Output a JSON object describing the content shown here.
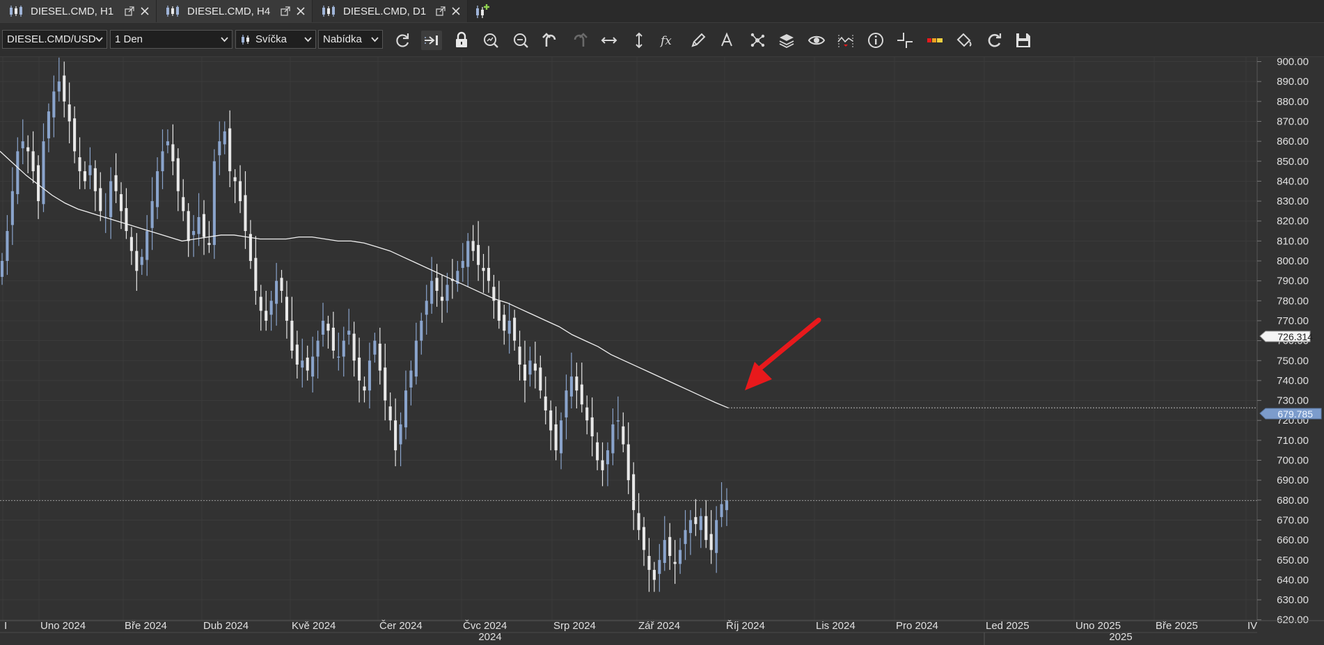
{
  "tabs": [
    {
      "label": "DIESEL.CMD, H1",
      "active": false
    },
    {
      "label": "DIESEL.CMD, H4",
      "active": false
    },
    {
      "label": "DIESEL.CMD, D1",
      "active": true
    }
  ],
  "toolbar": {
    "instrument": "DIESEL.CMD/USD",
    "period": "1 Den",
    "chart_type": "Svíčka",
    "price_side": "Nabídka",
    "icons": [
      "refresh-icon",
      "shift-chart-icon",
      "lock-icon",
      "zoom-in-icon",
      "zoom-out-icon",
      "undo-icon",
      "redo-icon",
      "horizontal-scale-icon",
      "vertical-scale-icon",
      "indicators-fx-icon",
      "pencil-draw-icon",
      "text-tool-icon",
      "objects-icon",
      "layers-icon",
      "eye-icon",
      "chart-signals-icon",
      "info-icon",
      "crosshair-icon",
      "color-bar-icon",
      "paint-bucket-icon",
      "cycle-icon",
      "save-icon"
    ]
  },
  "colors": {
    "background": "#323232",
    "bull_candle": "#8aa4cc",
    "bear_candle": "#e8e8e8",
    "moving_average": "#f0f0f0",
    "arrow": "#e8191c",
    "current_price_box": "#7c9ccc"
  },
  "chart_data": {
    "type": "candlestick",
    "symbol": "DIESEL.CMD/USD",
    "timeframe": "D1",
    "ylim": [
      620,
      900
    ],
    "y_ticks": [
      "900.00",
      "890.00",
      "880.00",
      "870.00",
      "860.00",
      "850.00",
      "840.00",
      "830.00",
      "820.00",
      "810.00",
      "800.00",
      "790.00",
      "780.00",
      "770.00",
      "760.00",
      "750.00",
      "740.00",
      "730.00",
      "720.00",
      "710.00",
      "700.00",
      "690.00",
      "680.00",
      "670.00",
      "660.00",
      "650.00",
      "640.00",
      "630.00",
      "620.00"
    ],
    "x_ticks": [
      "I",
      "Uno 2024",
      "Bře 2024",
      "Dub 2024",
      "Kvě 2024",
      "Čer 2024",
      "Čvc 2024",
      "Srp 2024",
      "Zář 2024",
      "Říj 2024",
      "Lis 2024",
      "Pro 2024",
      "Led 2025",
      "Uno 2025",
      "Bře 2025",
      "IV"
    ],
    "year_labels": [
      "2024",
      "2025"
    ],
    "ma_label": "726.314",
    "price_label": "679.785",
    "close_path": [
      800,
      815,
      835,
      855,
      860,
      855,
      845,
      830,
      860,
      875,
      885,
      890,
      880,
      870,
      855,
      845,
      840,
      848,
      835,
      825,
      822,
      840,
      835,
      825,
      815,
      805,
      795,
      802,
      815,
      830,
      845,
      855,
      860,
      850,
      835,
      825,
      810,
      815,
      822,
      812,
      808,
      850,
      860,
      865,
      845,
      840,
      830,
      815,
      800,
      785,
      775,
      770,
      780,
      790,
      785,
      770,
      755,
      748,
      750,
      745,
      752,
      760,
      770,
      765,
      755,
      752,
      760,
      765,
      750,
      740,
      735,
      750,
      760,
      745,
      730,
      720,
      705,
      718,
      735,
      745,
      760,
      770,
      780,
      790,
      785,
      780,
      788,
      790,
      795,
      800,
      810,
      805,
      798,
      795,
      790,
      780,
      770,
      765,
      770,
      760,
      748,
      740,
      750,
      745,
      735,
      725,
      715,
      705,
      720,
      735,
      742,
      735,
      728,
      720,
      712,
      700,
      695,
      705,
      718,
      720,
      708,
      690,
      675,
      665,
      655,
      645,
      640,
      650,
      660,
      652,
      648,
      655,
      665,
      670,
      668,
      672,
      660,
      655,
      670,
      678,
      680
    ],
    "moving_average": [
      855,
      849,
      843,
      838,
      833,
      829,
      826,
      824,
      822,
      820,
      818,
      816,
      814,
      812,
      810,
      811,
      812,
      813,
      813,
      812,
      811,
      811,
      811,
      812,
      812,
      811,
      810,
      810,
      809,
      807,
      805,
      802,
      799,
      796,
      793,
      790,
      787,
      784,
      781,
      779,
      776,
      773,
      770,
      767,
      763,
      760,
      757,
      753,
      750,
      747,
      744,
      741,
      738,
      735,
      732,
      729,
      726.3
    ]
  }
}
